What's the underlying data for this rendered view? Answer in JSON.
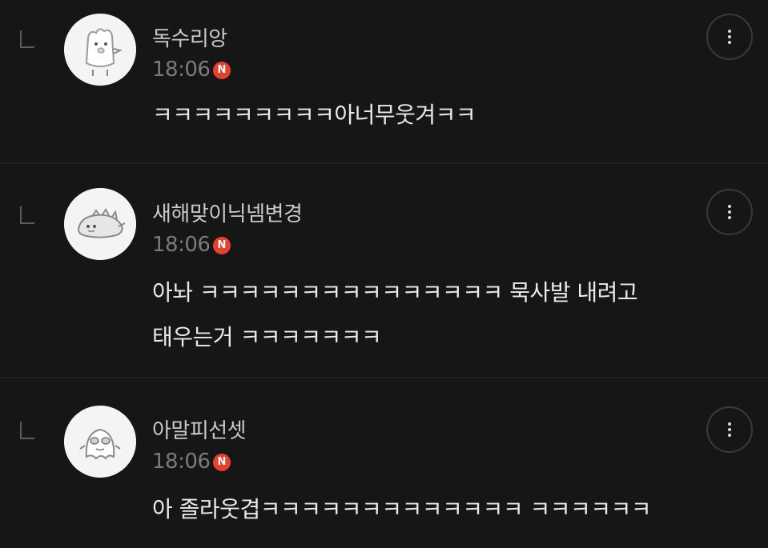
{
  "comments": [
    {
      "nickname": "독수리앙",
      "time": "18:06",
      "new_badge": "N",
      "lines": [
        "ㅋㅋㅋㅋㅋㅋㅋㅋㅋ아너무웃겨ㅋㅋ"
      ],
      "avatar_icon": "chick-character-icon"
    },
    {
      "nickname": "새해맞이닉넴변경",
      "time": "18:06",
      "new_badge": "N",
      "lines": [
        "아놔 ㅋㅋㅋㅋㅋㅋㅋㅋㅋㅋㅋㅋㅋㅋㅋ 묵사발 내려고",
        "태우는거 ㅋㅋㅋㅋㅋㅋㅋ"
      ],
      "avatar_icon": "dinosaur-character-icon"
    },
    {
      "nickname": "아말피선셋",
      "time": "18:06",
      "new_badge": "N",
      "lines": [
        "아 졸라웃겹ㅋㅋㅋㅋㅋㅋㅋㅋㅋㅋㅋㅋㅋ ㅋㅋㅋㅋㅋㅋ"
      ],
      "avatar_icon": "ghost-character-icon"
    }
  ],
  "colors": {
    "background": "#161616",
    "nickname": "#c9c9c9",
    "time": "#7b7b7b",
    "body_text": "#eaeaea",
    "new_badge": "#e8402f"
  },
  "icons": {
    "reply": "reply-arrow-icon",
    "more": "more-vertical-icon"
  }
}
